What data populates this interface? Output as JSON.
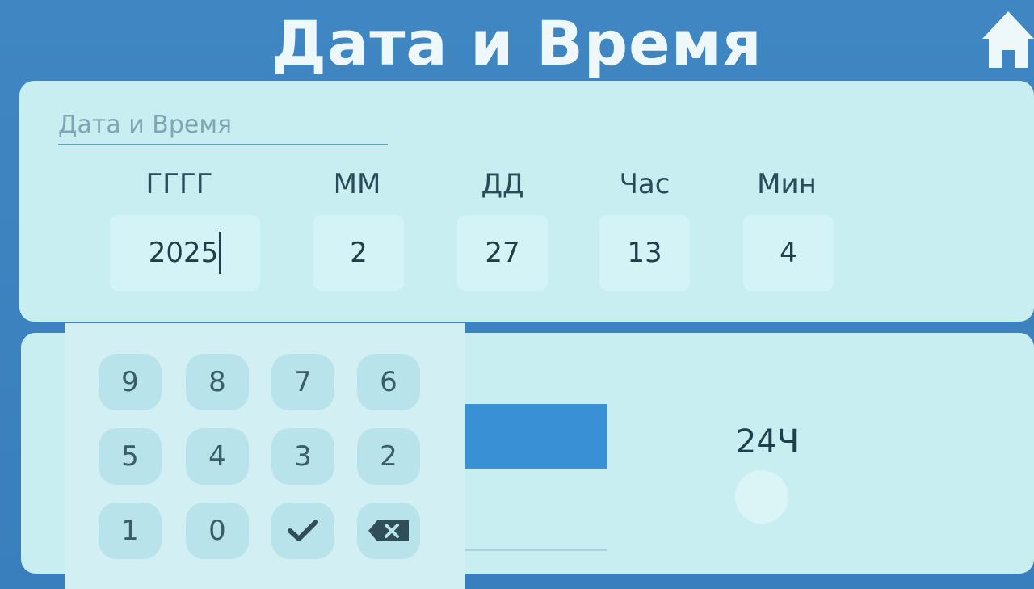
{
  "header": {
    "title": "Дата и Время"
  },
  "datetime": {
    "section_label": "Дата и Время",
    "fields": [
      {
        "label": "ГГГГ",
        "value": "2025"
      },
      {
        "label": "ММ",
        "value": "2"
      },
      {
        "label": "ДД",
        "value": "27"
      },
      {
        "label": "Час",
        "value": "13"
      },
      {
        "label": "Мин",
        "value": "4"
      }
    ]
  },
  "time_format": {
    "label": "24Ч"
  },
  "keypad": {
    "keys": [
      "9",
      "8",
      "7",
      "6",
      "5",
      "4",
      "3",
      "2",
      "1",
      "0"
    ],
    "confirm_icon": "check-icon",
    "backspace_icon": "backspace-icon"
  },
  "colors": {
    "background": "#3f86c2",
    "card": "#c8eef2",
    "accent": "#3a90d4"
  }
}
